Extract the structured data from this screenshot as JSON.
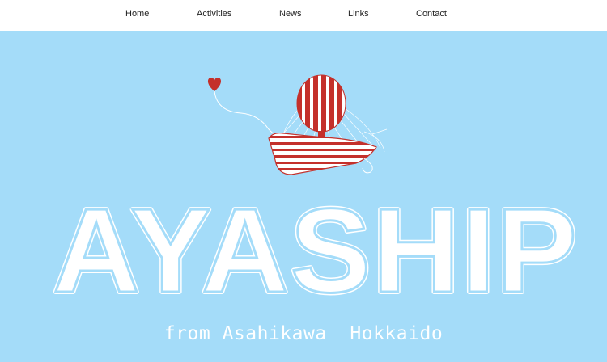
{
  "nav": {
    "items": [
      {
        "label": "Home"
      },
      {
        "label": "Activities"
      },
      {
        "label": "News"
      },
      {
        "label": "Links"
      },
      {
        "label": "Contact"
      }
    ]
  },
  "hero": {
    "logo_text": "AYASHIP",
    "tagline": "from Asahikawa  Hokkaido"
  },
  "colors": {
    "hero_background": "#a4dcf9",
    "accent_red": "#c4302b",
    "logo_white": "#ffffff"
  },
  "icons": [
    "heart-icon",
    "hot-air-balloon-ship-illustration"
  ]
}
